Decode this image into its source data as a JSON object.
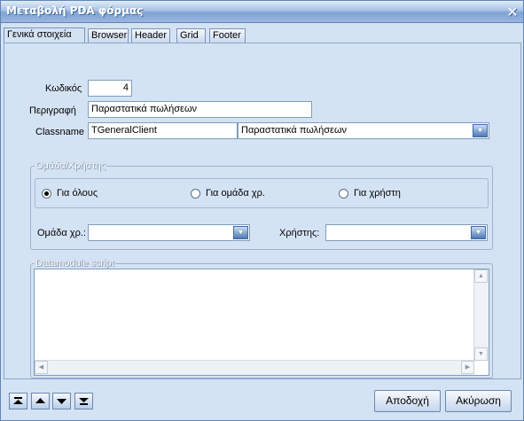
{
  "window": {
    "title": "Μεταβολή  PDA φόρμας",
    "close_label": "✕"
  },
  "tabs": [
    {
      "label": "Γενικά στοιχεία",
      "active": true
    },
    {
      "label": "Browser"
    },
    {
      "label": "Header"
    },
    {
      "label": "Grid"
    },
    {
      "label": "Footer"
    }
  ],
  "form": {
    "code_label": "Κωδικός",
    "code_value": "4",
    "description_label": "Περιγραφή",
    "description_value": "Παραστατικά πωλήσεων",
    "classname_label": "Classname",
    "classname_value": "TGeneralClient",
    "classname_select_value": "Παραστατικά πωλήσεων"
  },
  "group_user": {
    "title": "Ομάδα/Χρήστης",
    "options": [
      {
        "label": "Για όλους",
        "checked": true
      },
      {
        "label": "Για ομάδα χρ.",
        "checked": false
      },
      {
        "label": "Για χρήστη",
        "checked": false
      }
    ],
    "group_label": "Ομάδα χρ.:",
    "group_value": "",
    "user_label": "Χρήστης:",
    "user_value": ""
  },
  "script_group": {
    "title": "Datamodule script",
    "content": ""
  },
  "footer": {
    "nav_icons": [
      "first-icon",
      "up-icon",
      "down-icon",
      "last-icon"
    ],
    "ok_label": "Αποδοχή",
    "cancel_label": "Ακύρωση"
  }
}
